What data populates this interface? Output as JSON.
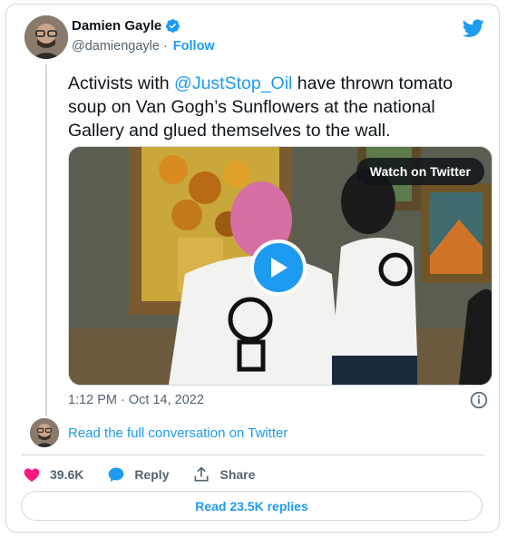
{
  "author": {
    "name": "Damien Gayle",
    "handle": "@damiengayle",
    "separator": "·",
    "follow_label": "Follow"
  },
  "tweet": {
    "text_before": "Activists with ",
    "mention": "@JustStop_Oil",
    "text_after": " have thrown tomato soup on Van Gogh’s Sunflowers at the national Gallery and glued themselves to the wall.",
    "timestamp": "1:12 PM · Oct 14, 2022"
  },
  "media": {
    "watch_label": "Watch on Twitter"
  },
  "conversation": {
    "link_label": "Read the full conversation on Twitter"
  },
  "actions": {
    "likes": "39.6K",
    "reply_label": "Reply",
    "share_label": "Share"
  },
  "replies_button": "Read 23.5K replies",
  "colors": {
    "accent": "#1d9bf0",
    "like": "#f91880",
    "text": "#0f1419",
    "muted": "#536471",
    "border": "#cfd9de"
  },
  "icons": [
    "verified-icon",
    "twitter-bird-icon",
    "play-icon",
    "info-icon",
    "heart-icon",
    "reply-bubble-icon",
    "share-icon"
  ]
}
